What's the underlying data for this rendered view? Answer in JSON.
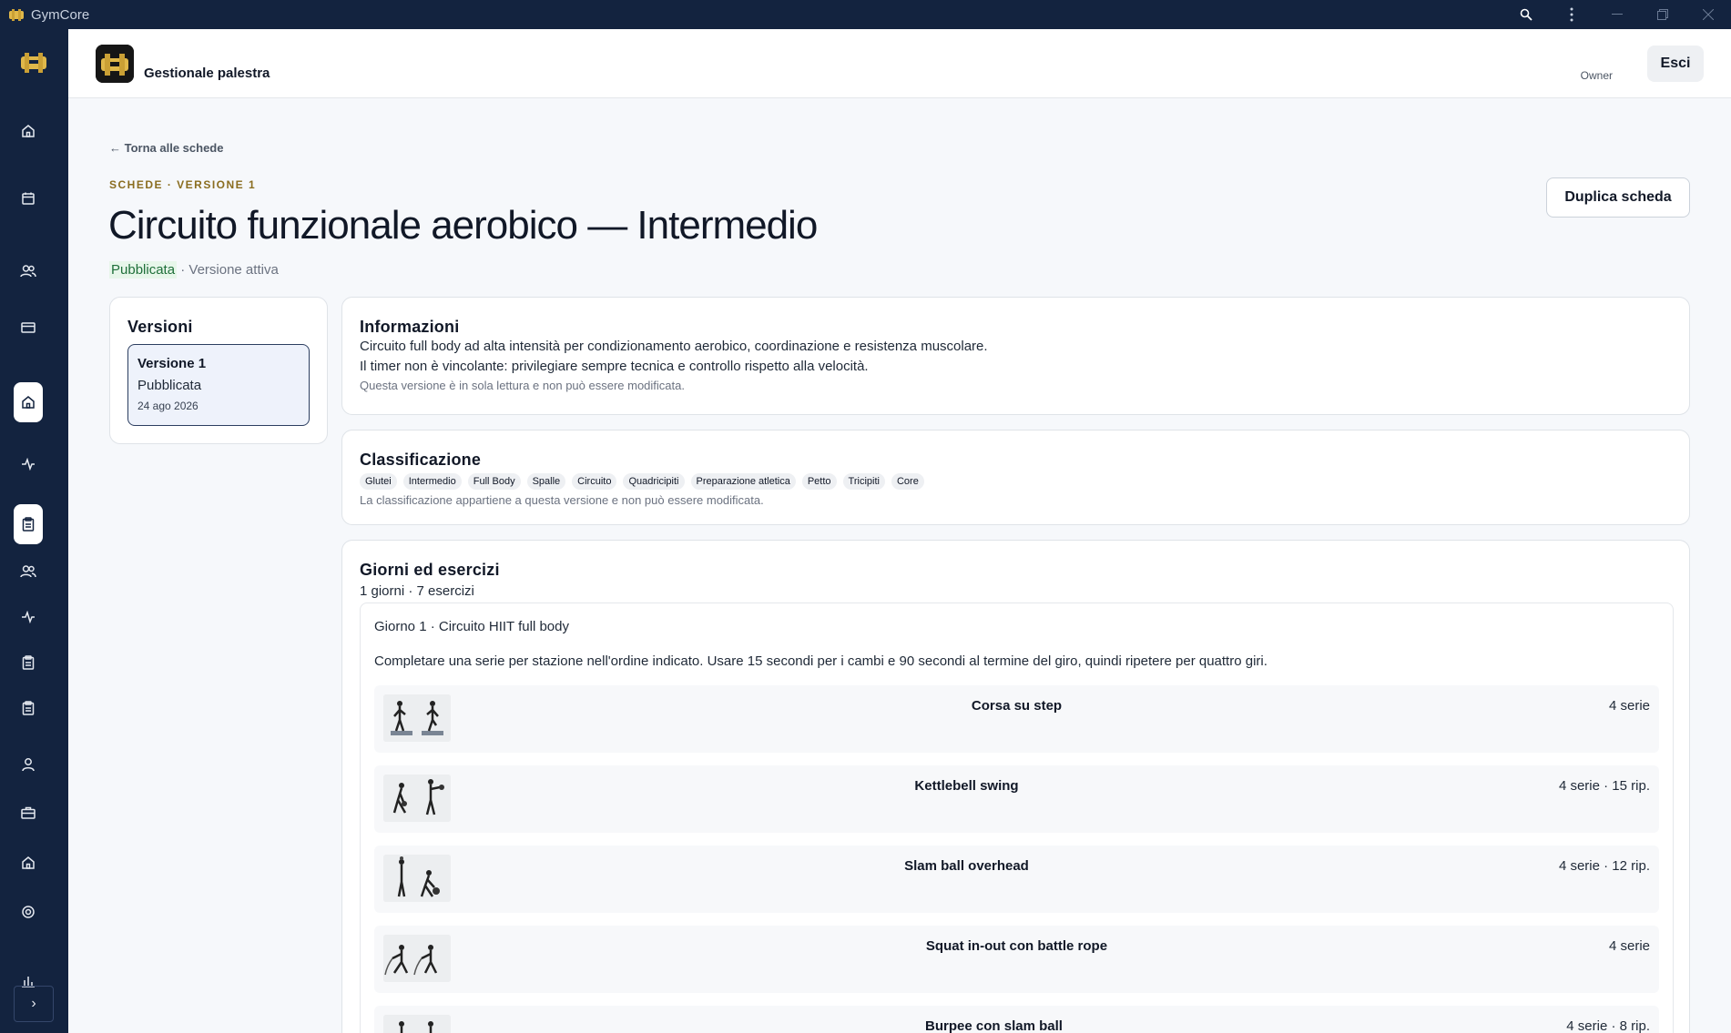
{
  "window": {
    "title": "GymCore"
  },
  "header": {
    "brand": "Gestionale palestra",
    "role": "Owner",
    "logout_label": "Esci"
  },
  "page": {
    "back_link": "← Torna alle schede",
    "eyebrow": "SCHEDE · VERSIONE 1",
    "title": "Circuito funzionale aerobico — Intermedio",
    "status_badge": "Pubblicata",
    "status_rest": " · Versione attiva",
    "duplicate_label": "Duplica scheda"
  },
  "versions": {
    "heading": "Versioni",
    "items": [
      {
        "title": "Versione 1",
        "status": "Pubblicata",
        "date": "24 ago 2026"
      }
    ]
  },
  "info": {
    "heading": "Informazioni",
    "line1": "Circuito full body ad alta intensità per condizionamento aerobico, coordinazione e resistenza muscolare.",
    "line2": "Il timer non è vincolante: privilegiare sempre tecnica e controllo rispetto alla velocità.",
    "note": "Questa versione è in sola lettura e non può essere modificata."
  },
  "classification": {
    "heading": "Classificazione",
    "tags": [
      "Glutei",
      "Intermedio",
      "Full Body",
      "Spalle",
      "Circuito",
      "Quadricipiti",
      "Preparazione atletica",
      "Petto",
      "Tricipiti",
      "Core"
    ],
    "note": "La classificazione appartiene a questa versione e non può essere modificata."
  },
  "days": {
    "heading": "Giorni ed esercizi",
    "summary": "1 giorni · 7 esercizi",
    "day1": {
      "title": "Giorno 1 · Circuito HIIT full body",
      "description": "Completare una serie per stazione nell'ordine indicato. Usare 15 secondi per i cambi e 90 secondi al termine del giro, quindi ripetere per quattro giri.",
      "exercises": [
        {
          "name": "Corsa su step",
          "meta": "4 serie"
        },
        {
          "name": "Kettlebell swing",
          "meta": "4 serie · 15 rip."
        },
        {
          "name": "Slam ball overhead",
          "meta": "4 serie · 12 rip."
        },
        {
          "name": "Squat in-out con battle rope",
          "meta": "4 serie"
        },
        {
          "name": "Burpee con slam ball",
          "meta": "4 serie · 8 rip."
        }
      ]
    }
  }
}
